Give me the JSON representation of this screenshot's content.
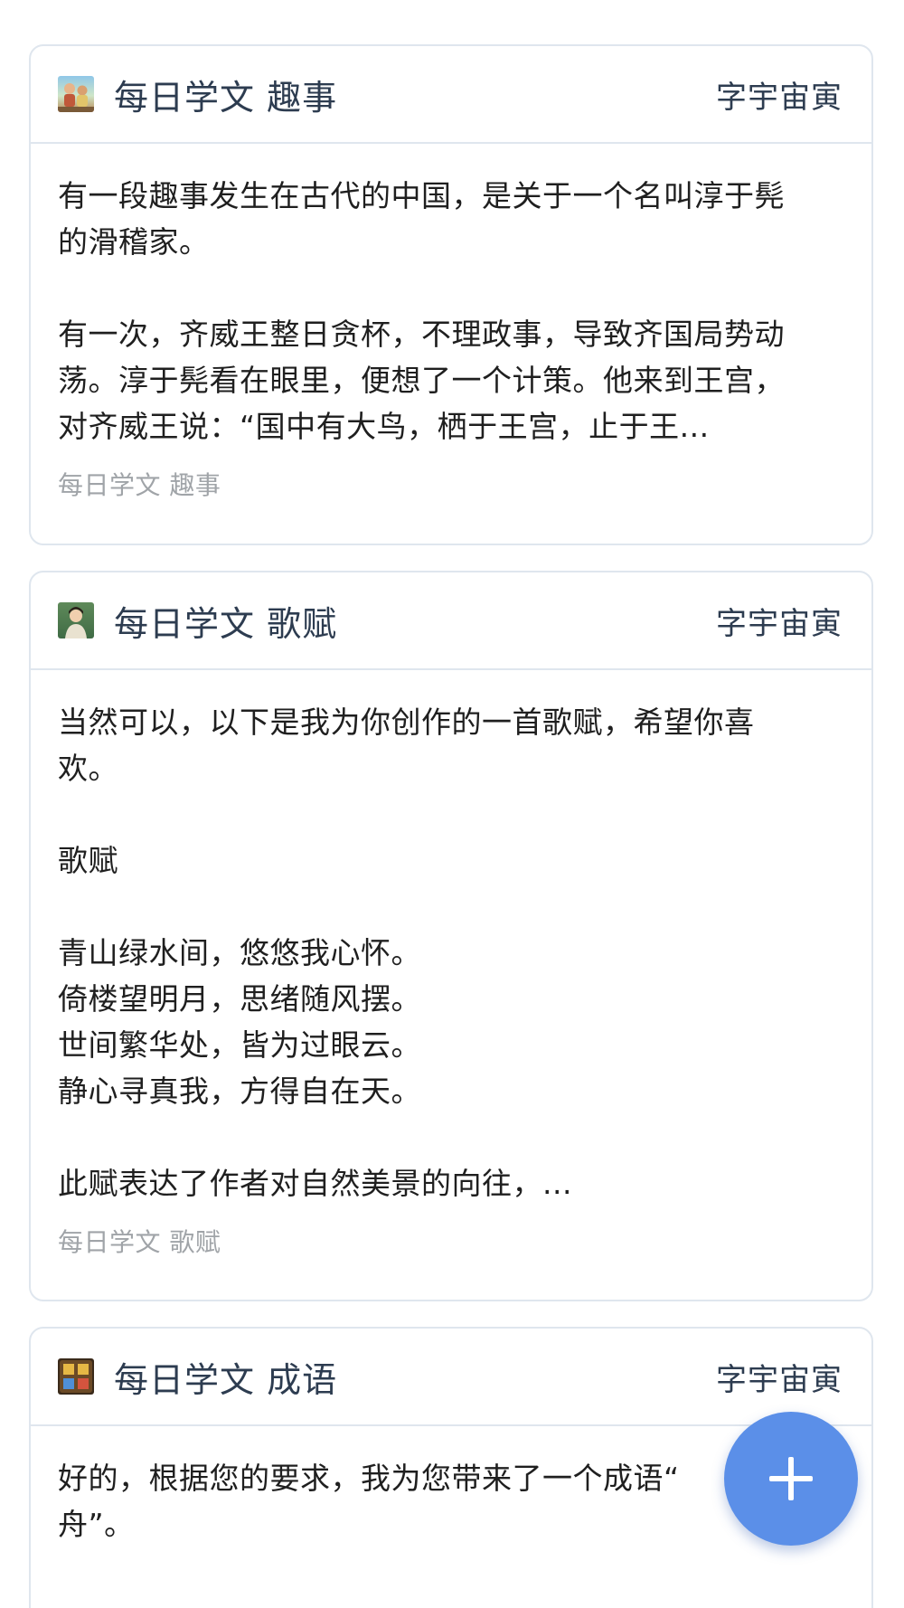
{
  "cards": [
    {
      "title": "每日学文 趣事",
      "author": "字宇宙寅",
      "thumb_icon": "cartoon-kids-thumbnail",
      "text": "有一段趣事发生在古代的中国，是关于一个名叫淳于髡\n的滑稽家。\n\n有一次，齐威王整日贪杯，不理政事，导致齐国局势动\n荡。淳于髡看在眼里，便想了一个计策。他来到王宫，\n对齐威王说：“国中有大鸟，栖于王宫，止于王...",
      "footer": "每日学文 趣事"
    },
    {
      "title": "每日学文 歌赋",
      "author": "字宇宙寅",
      "thumb_icon": "woman-portrait-thumbnail",
      "text": "当然可以，以下是我为你创作的一首歌赋，希望你喜\n欢。\n\n歌赋\n\n青山绿水间，悠悠我心怀。\n倚楼望明月，思绪随风摆。\n世间繁华处，皆为过眼云。\n静心寻真我，方得自在天。\n\n此赋表达了作者对自然美景的向往，...",
      "footer": "每日学文 歌赋"
    },
    {
      "title": "每日学文 成语",
      "author": "字宇宙寅",
      "thumb_icon": "game-board-thumbnail",
      "text": "好的，根据您的要求，我为您带来了一个成语“\n舟”。",
      "footer": ""
    }
  ],
  "fab": {
    "icon": "plus-icon",
    "color": "#5b8fe8"
  },
  "colors": {
    "title": "#2d3c50",
    "border": "#dfe6ee",
    "footer": "#a0a4a8"
  }
}
